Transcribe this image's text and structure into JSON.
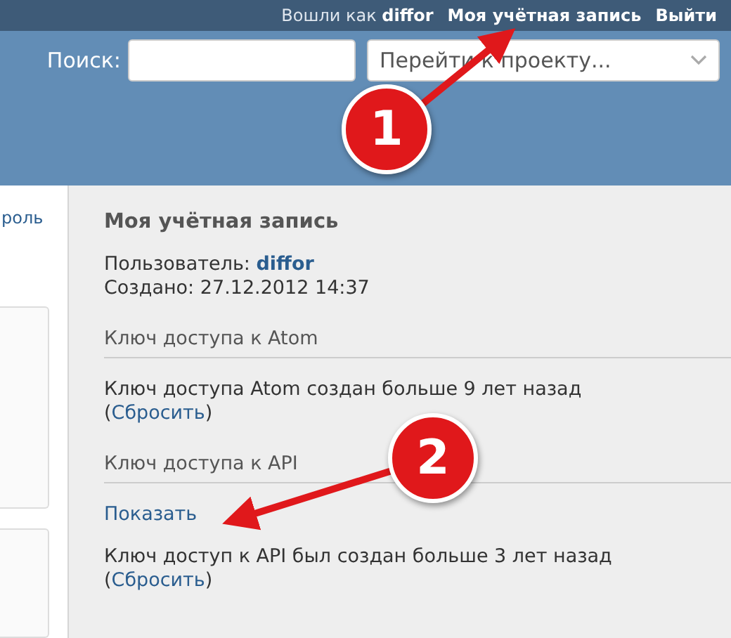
{
  "top_bar": {
    "logged_in_label": "Вошли как",
    "username": "diffor",
    "links": [
      "Моя учётная запись",
      "Выйти"
    ]
  },
  "header": {
    "search_label": "Поиск:",
    "project_select": {
      "placeholder": "Перейти к проекту..."
    }
  },
  "left_column": {
    "link": "роль"
  },
  "sidebar": {
    "title": "Моя учётная запись",
    "user_label": "Пользователь:",
    "user_value": "diffor",
    "created": "Создано: 27.12.2012 14:37",
    "sections": [
      {
        "heading": "Ключ доступа к Atom",
        "kind": "plain",
        "text": "Ключ доступа Atom создан больше 9 лет назад",
        "reset_open": "(",
        "reset": "Сбросить",
        "reset_close": ")"
      },
      {
        "heading": "Ключ доступа к API",
        "kind": "show",
        "show": "Показать",
        "text": "Ключ доступ к API был создан больше 3 лет назад",
        "reset_open": "(",
        "reset": "Сбросить",
        "reset_close": ")"
      }
    ]
  },
  "annotations": [
    {
      "number": "1"
    },
    {
      "number": "2"
    }
  ]
}
